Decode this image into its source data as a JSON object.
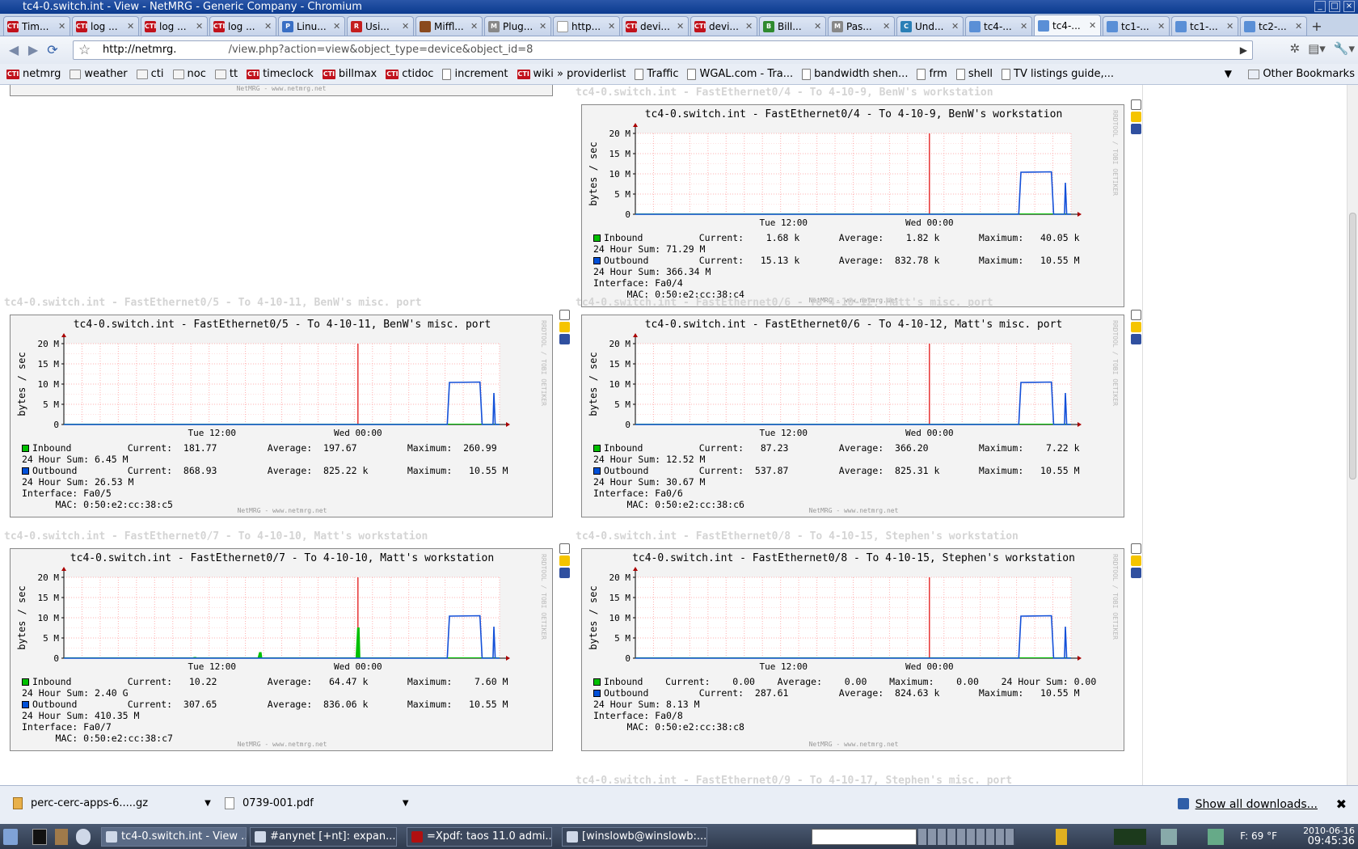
{
  "window": {
    "title": "tc4-0.switch.int - View - NetMRG - Generic Company - Chromium"
  },
  "tabs": [
    {
      "label": "Tim...",
      "fav": "CTI",
      "color": "#c1121c"
    },
    {
      "label": "log ...",
      "fav": "CTI",
      "color": "#c1121c"
    },
    {
      "label": "log ...",
      "fav": "CTI",
      "color": "#c1121c"
    },
    {
      "label": "log ...",
      "fav": "CTI",
      "color": "#c1121c"
    },
    {
      "label": "Linu...",
      "fav": "P",
      "color": "#3a6fc4"
    },
    {
      "label": "Usi...",
      "fav": "R",
      "color": "#c41e1e"
    },
    {
      "label": "Miffl...",
      "fav": "",
      "color": "#8a4a1e"
    },
    {
      "label": "Plug...",
      "fav": "M",
      "color": "#888888"
    },
    {
      "label": "http...",
      "fav": "",
      "color": "#ffffff"
    },
    {
      "label": "devi...",
      "fav": "CTI",
      "color": "#c1121c"
    },
    {
      "label": "devi...",
      "fav": "CTI",
      "color": "#c1121c"
    },
    {
      "label": "Bill...",
      "fav": "B",
      "color": "#2f8a2f"
    },
    {
      "label": "Pas...",
      "fav": "M",
      "color": "#888888"
    },
    {
      "label": "Und...",
      "fav": "C",
      "color": "#2a7fb6"
    },
    {
      "label": "tc4-...",
      "fav": "",
      "color": "#5a8fd6"
    },
    {
      "label": "tc4-...",
      "fav": "",
      "color": "#5a8fd6",
      "active": true
    },
    {
      "label": "tc1-...",
      "fav": "",
      "color": "#5a8fd6"
    },
    {
      "label": "tc1-...",
      "fav": "",
      "color": "#5a8fd6"
    },
    {
      "label": "tc2-...",
      "fav": "",
      "color": "#5a8fd6"
    }
  ],
  "address": {
    "host": "http://netmrg.",
    "path": "/view.php?action=view&object_type=device&object_id=8"
  },
  "bookmarks": [
    {
      "label": "netmrg",
      "kind": "cti"
    },
    {
      "label": "weather",
      "kind": "folder"
    },
    {
      "label": "cti",
      "kind": "folder"
    },
    {
      "label": "noc",
      "kind": "folder"
    },
    {
      "label": "tt",
      "kind": "folder"
    },
    {
      "label": "timeclock",
      "kind": "cti"
    },
    {
      "label": "billmax",
      "kind": "cti"
    },
    {
      "label": "ctidoc",
      "kind": "cti"
    },
    {
      "label": "increment",
      "kind": "page"
    },
    {
      "label": "wiki » providerlist",
      "kind": "cti"
    },
    {
      "label": "Traffic",
      "kind": "page"
    },
    {
      "label": "WGAL.com - Tra...",
      "kind": "page"
    },
    {
      "label": "bandwidth shen...",
      "kind": "page"
    },
    {
      "label": "frm",
      "kind": "page"
    },
    {
      "label": "shell",
      "kind": "page"
    },
    {
      "label": "TV listings guide,...",
      "kind": "page"
    }
  ],
  "other_bookmarks": "Other Bookmarks",
  "top_footer": "NetMRG - www.netmrg.net",
  "graphs": [
    {
      "section_title": "tc4-0.switch.int - FastEthernet0/4 - To 4-10-9, BenW's workstation",
      "title": "tc4-0.switch.int - FastEthernet0/4 - To 4-10-9, BenW's workstation",
      "yaxis_label": "bytes / sec",
      "yticks": [
        "20 M",
        "15 M",
        "10 M",
        "5 M",
        "0"
      ],
      "xticks": [
        "Tue 12:00",
        "Wed 00:00"
      ],
      "legend_lines": [
        {
          "sq": "#00c000",
          "text": "Inbound          Current:    1.68 k       Average:    1.82 k       Maximum:   40.05 k"
        },
        {
          "text": "24 Hour Sum: 71.29 M"
        },
        {
          "sq": "#0050d8",
          "text": "Outbound         Current:   15.13 k       Average:  832.78 k       Maximum:   10.55 M"
        },
        {
          "text": "24 Hour Sum: 366.34 M"
        },
        {
          "text": "Interface: Fa0/4"
        },
        {
          "text": "      MAC: 0:50:e2:cc:38:c4"
        }
      ],
      "footer": "NetMRG - www.netmrg.net",
      "rrd": "RRDTOOL / TOBI OETIKER",
      "in_spikes": []
    },
    {
      "section_title": "tc4-0.switch.int - FastEthernet0/5 - To 4-10-11, BenW's misc. port",
      "title": "tc4-0.switch.int - FastEthernet0/5 - To 4-10-11, BenW's misc. port",
      "yaxis_label": "bytes / sec",
      "yticks": [
        "20 M",
        "15 M",
        "10 M",
        "5 M",
        "0"
      ],
      "xticks": [
        "Tue 12:00",
        "Wed 00:00"
      ],
      "legend_lines": [
        {
          "sq": "#00c000",
          "text": "Inbound          Current:  181.77         Average:  197.67         Maximum:  260.99"
        },
        {
          "text": "24 Hour Sum: 6.45 M"
        },
        {
          "sq": "#0050d8",
          "text": "Outbound         Current:  868.93         Average:  825.22 k       Maximum:   10.55 M"
        },
        {
          "text": "24 Hour Sum: 26.53 M"
        },
        {
          "text": "Interface: Fa0/5"
        },
        {
          "text": "      MAC: 0:50:e2:cc:38:c5"
        }
      ],
      "footer": "NetMRG - www.netmrg.net",
      "rrd": "RRDTOOL / TOBI OETIKER",
      "in_spikes": []
    },
    {
      "section_title": "tc4-0.switch.int - FastEthernet0/6 - To 4-10-12, Matt's misc. port",
      "title": "tc4-0.switch.int - FastEthernet0/6 - To 4-10-12, Matt's misc. port",
      "yaxis_label": "bytes / sec",
      "yticks": [
        "20 M",
        "15 M",
        "10 M",
        "5 M",
        "0"
      ],
      "xticks": [
        "Tue 12:00",
        "Wed 00:00"
      ],
      "legend_lines": [
        {
          "sq": "#00c000",
          "text": "Inbound          Current:   87.23         Average:  366.20         Maximum:    7.22 k"
        },
        {
          "text": "24 Hour Sum: 12.52 M"
        },
        {
          "sq": "#0050d8",
          "text": "Outbound         Current:  537.87         Average:  825.31 k       Maximum:   10.55 M"
        },
        {
          "text": "24 Hour Sum: 30.67 M"
        },
        {
          "text": "Interface: Fa0/6"
        },
        {
          "text": "      MAC: 0:50:e2:cc:38:c6"
        }
      ],
      "footer": "NetMRG - www.netmrg.net",
      "rrd": "RRDTOOL / TOBI OETIKER",
      "in_spikes": []
    },
    {
      "section_title": "tc4-0.switch.int - FastEthernet0/7 - To 4-10-10, Matt's workstation",
      "title": "tc4-0.switch.int - FastEthernet0/7 - To 4-10-10, Matt's workstation",
      "yaxis_label": "bytes / sec",
      "yticks": [
        "20 M",
        "15 M",
        "10 M",
        "5 M",
        "0"
      ],
      "xticks": [
        "Tue 12:00",
        "Wed 00:00"
      ],
      "legend_lines": [
        {
          "sq": "#00c000",
          "text": "Inbound          Current:   10.22         Average:   64.47 k       Maximum:    7.60 M"
        },
        {
          "text": "24 Hour Sum: 2.40 G"
        },
        {
          "sq": "#0050d8",
          "text": "Outbound         Current:  307.65         Average:  836.06 k       Maximum:   10.55 M"
        },
        {
          "text": "24 Hour Sum: 410.35 M"
        },
        {
          "text": "Interface: Fa0/7"
        },
        {
          "text": "      MAC: 0:50:e2:cc:38:c7"
        }
      ],
      "footer": "NetMRG - www.netmrg.net",
      "rrd": "RRDTOOL / TOBI OETIKER",
      "in_spikes": [
        {
          "t": 0.3,
          "v": 0.3
        },
        {
          "t": 0.45,
          "v": 1.5
        },
        {
          "t": 0.675,
          "v": 7.6
        }
      ]
    },
    {
      "section_title": "tc4-0.switch.int - FastEthernet0/8 - To 4-10-15, Stephen's workstation",
      "title": "tc4-0.switch.int - FastEthernet0/8 - To 4-10-15, Stephen's workstation",
      "yaxis_label": "bytes / sec",
      "yticks": [
        "20 M",
        "15 M",
        "10 M",
        "5 M",
        "0"
      ],
      "xticks": [
        "Tue 12:00",
        "Wed 00:00"
      ],
      "legend_lines": [
        {
          "sq": "#00c000",
          "text": "Inbound    Current:    0.00    Average:    0.00    Maximum:    0.00    24 Hour Sum: 0.00"
        },
        {
          "sq": "#0050d8",
          "text": "Outbound         Current:  287.61         Average:  824.63 k       Maximum:   10.55 M"
        },
        {
          "text": "24 Hour Sum: 8.13 M"
        },
        {
          "text": "Interface: Fa0/8"
        },
        {
          "text": "      MAC: 0:50:e2:cc:38:c8"
        }
      ],
      "footer": "NetMRG - www.netmrg.net",
      "rrd": "RRDTOOL / TOBI OETIKER",
      "in_spikes": []
    }
  ],
  "next_section_title": "tc4-0.switch.int - FastEthernet0/9 - To 4-10-17, Stephen's misc. port",
  "chart_data": {
    "type": "line",
    "ylabel": "bytes / sec",
    "ylim": [
      0,
      20
    ],
    "yunit": "M",
    "x_ticks": [
      "Tue 12:00",
      "Wed 00:00"
    ],
    "outbound_profile": [
      {
        "t": 0.0,
        "v": 0
      },
      {
        "t": 0.88,
        "v": 0
      },
      {
        "t": 0.885,
        "v": 10.4
      },
      {
        "t": 0.955,
        "v": 10.5
      },
      {
        "t": 0.96,
        "v": 0
      },
      {
        "t": 0.985,
        "v": 0
      },
      {
        "t": 0.987,
        "v": 7.8
      },
      {
        "t": 0.99,
        "v": 0
      },
      {
        "t": 1.0,
        "v": 0
      }
    ]
  },
  "downloads": [
    {
      "label": "perc-cerc-apps-6.....gz"
    },
    {
      "label": "0739-001.pdf"
    }
  ],
  "show_all_downloads": "Show all downloads...",
  "taskbar": {
    "items": [
      {
        "label": "tc4-0.switch.int - View ...",
        "active": true
      },
      {
        "label": "#anynet [+nt]: expan..."
      },
      {
        "label": "=Xpdf: taos 11.0 admi..."
      },
      {
        "label": "[winslowb@winslowb:..."
      }
    ],
    "temp": "F: 69 °F",
    "date": "2010-06-16",
    "time": "09:45:36"
  }
}
